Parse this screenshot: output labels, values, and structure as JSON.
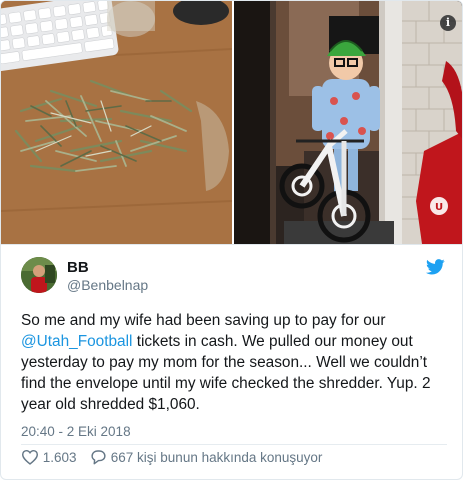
{
  "author": {
    "display_name": "BB",
    "handle": "@Benbelnap"
  },
  "tweet": {
    "text_before_mention": "So me and my wife had been saving up to pay for our ",
    "mention": "@Utah_Football",
    "text_after_mention": " tickets in cash. We pulled our money out yesterday to pay my mom for the season... Well we couldn’t find the envelope until my wife checked the shredder. Yup. 2 year old shredded $1,060.",
    "timestamp": "20:40 - 2 Eki 2018"
  },
  "stats": {
    "likes": "1.603",
    "conversation": "667 kişi bunun hakkında konuşuyor"
  },
  "icons": {
    "info": "info-icon",
    "brand": "twitter-bird-icon",
    "like": "heart-icon",
    "reply": "speech-bubble-icon"
  },
  "colors": {
    "link": "#1b95e0",
    "text": "#14171a",
    "secondary": "#657786",
    "border": "#e1e8ed"
  }
}
